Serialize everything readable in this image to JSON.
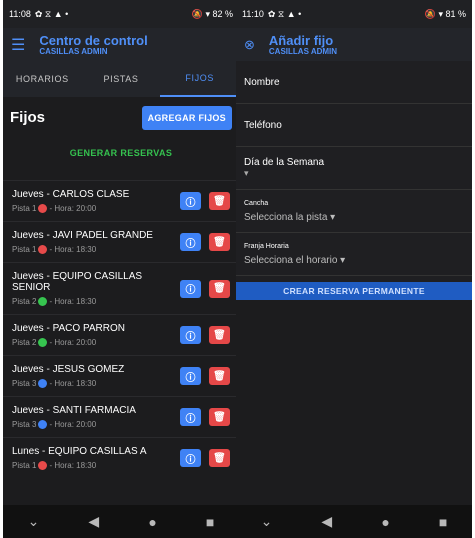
{
  "left_phone": {
    "status": {
      "time": "11:08",
      "icons": "✿ ⧖ ▲ •",
      "right": "🔕 ▾ 82 %"
    },
    "appbar": {
      "menu_icon": "menu-icon",
      "title": "Centro de control",
      "subtitle": "CASILLAS ADMIN"
    },
    "tabs": [
      "HORARIOS",
      "PISTAS",
      "FIJOS"
    ],
    "heading": "Fijos",
    "add_button": "AGREGAR FIJOS",
    "generate_button": "GENERAR RESERVAS",
    "items": [
      {
        "line": "Jueves - CARLOS CLASE",
        "pista": "Pista 1",
        "dot": "#e74a4a",
        "time": "- Hora: 20:00"
      },
      {
        "line": "Jueves - JAVI PADEL GRANDE",
        "pista": "Pista 1",
        "dot": "#e74a4a",
        "time": "- Hora: 18:30"
      },
      {
        "line": "Jueves - EQUIPO CASILLAS SENIOR",
        "pista": "Pista 2",
        "dot": "#36c44f",
        "time": "- Hora: 18:30"
      },
      {
        "line": "Jueves - PACO PARRON",
        "pista": "Pista 2",
        "dot": "#36c44f",
        "time": "- Hora: 20:00"
      },
      {
        "line": "Jueves - JESUS GOMEZ",
        "pista": "Pista 3",
        "dot": "#3f82f5",
        "time": "- Hora: 18:30"
      },
      {
        "line": "Jueves - SANTI FARMACIA",
        "pista": "Pista 3",
        "dot": "#3f82f5",
        "time": "- Hora: 20:00"
      },
      {
        "line": "Lunes - EQUIPO CASILLAS A",
        "pista": "Pista 1",
        "dot": "#e74a4a",
        "time": "- Hora: 18:30"
      }
    ]
  },
  "right_phone": {
    "status": {
      "time": "11:10",
      "icons": "✿ ⧖ ▲ •",
      "right": "🔕 ▾ 81 %"
    },
    "appbar": {
      "close_icon": "close-circle-icon",
      "title": "Añadir fijo",
      "subtitle": "CASILLAS ADMIN"
    },
    "fields": {
      "name": "Nombre",
      "phone": "Teléfono",
      "weekday": "Día de la Semana",
      "court_label": "Cancha",
      "court_placeholder": "Selecciona la pista",
      "slot_label": "Franja Horaria",
      "slot_placeholder": "Selecciona el horario",
      "submit": "CREAR RESERVA PERMANENTE"
    }
  }
}
